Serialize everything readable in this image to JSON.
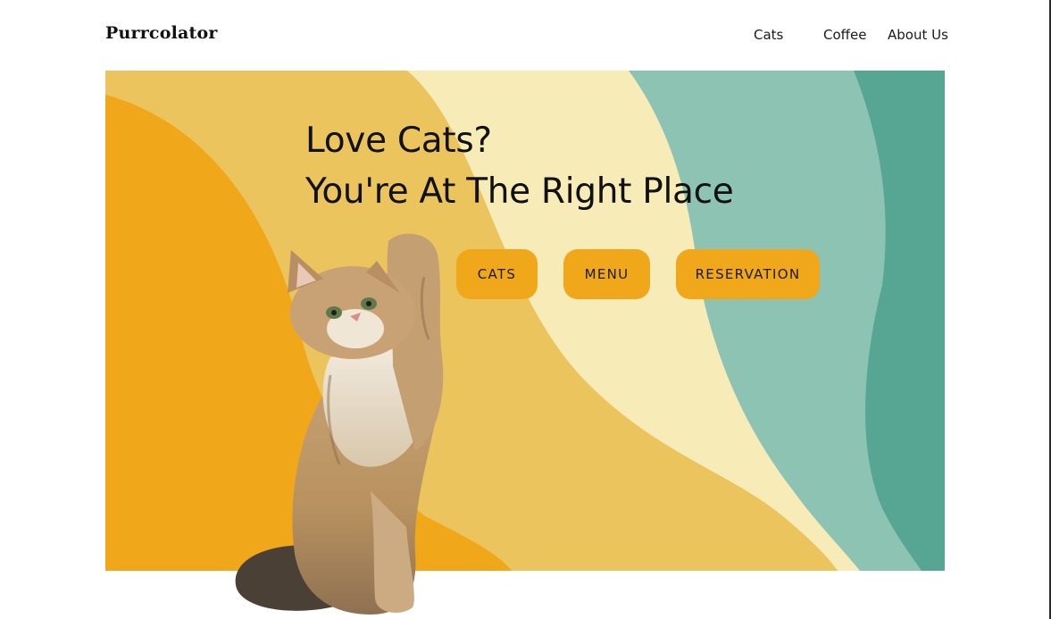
{
  "header": {
    "brand": "Purrcolator",
    "nav": [
      "Cats",
      "Coffee",
      "About Us"
    ]
  },
  "hero": {
    "title_line1": "Love Cats?",
    "title_line2": "You're At The Right Place",
    "buttons": [
      "CATS",
      "MENU",
      "RESERVATION"
    ],
    "image": "cat-reaching-up-photo"
  },
  "colors": {
    "orange": "#f0a81a",
    "sand": "#ecc45e",
    "cream": "#f7ebb8",
    "mint": "#8dc3b3",
    "teal": "#57a593",
    "button": "#f0a81a"
  }
}
